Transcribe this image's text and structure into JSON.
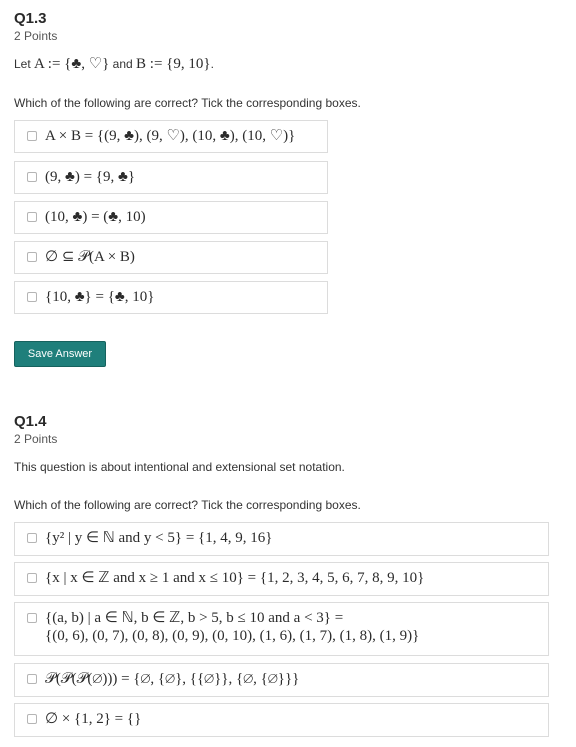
{
  "q13": {
    "title": "Q1.3",
    "points": "2 Points",
    "let_prefix": "Let ",
    "let_a": "A := {♣, ♡}",
    "let_and": " and ",
    "let_b": "B := {9, 10}",
    "let_suffix": ".",
    "instruction": "Which of the following are correct? Tick the corresponding boxes.",
    "options": [
      "A × B = {(9, ♣), (9, ♡), (10, ♣), (10, ♡)}",
      "(9, ♣) = {9, ♣}",
      "(10, ♣) = (♣, 10)",
      "∅ ⊆ 𝒫(A × B)",
      "{10, ♣} = {♣, 10}"
    ],
    "save_label": "Save Answer"
  },
  "q14": {
    "title": "Q1.4",
    "points": "2 Points",
    "intro": "This question is about intentional and extensional set notation.",
    "instruction": "Which of the following are correct? Tick the corresponding boxes.",
    "options": [
      "{y² | y ∈ ℕ and y < 5} = {1, 4, 9, 16}",
      "{x | x ∈ ℤ and x ≥ 1 and x ≤ 10} = {1, 2, 3, 4, 5, 6, 7, 8, 9, 10}",
      "{(a, b) | a ∈ ℕ, b ∈ ℤ, b > 5, b ≤ 10 and a < 3} =",
      "𝒫(𝒫(𝒫(∅))) = {∅, {∅}, {{∅}}, {∅, {∅}}}",
      "∅ × {1, 2} = {}"
    ],
    "option3_line2": "{(0, 6), (0, 7), (0, 8), (0, 9), (0, 10), (1, 6), (1, 7), (1, 8), (1, 9)}"
  }
}
